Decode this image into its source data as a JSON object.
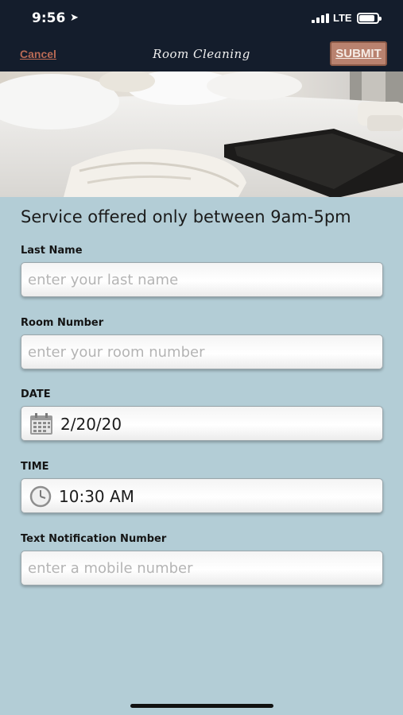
{
  "status_bar": {
    "time": "9:56",
    "carrier": "LTE"
  },
  "nav": {
    "cancel_label": "Cancel",
    "title": "Room Cleaning",
    "submit_label": "SUBMIT"
  },
  "notice": "Service offered only between 9am-5pm",
  "form": {
    "last_name": {
      "label": "Last Name",
      "placeholder": "enter your last name",
      "value": ""
    },
    "room_number": {
      "label": "Room Number",
      "placeholder": "enter your room number",
      "value": ""
    },
    "date": {
      "label": "DATE",
      "value": "2/20/20",
      "icon": "calendar-icon"
    },
    "time": {
      "label": "TIME",
      "value": "10:30 AM",
      "icon": "clock-icon"
    },
    "notification": {
      "label": "Text Notification Number",
      "placeholder": "enter a mobile number",
      "value": ""
    }
  },
  "colors": {
    "background": "#b3cdd6",
    "nav_bar": "#141d2c",
    "accent": "#b9826f"
  }
}
